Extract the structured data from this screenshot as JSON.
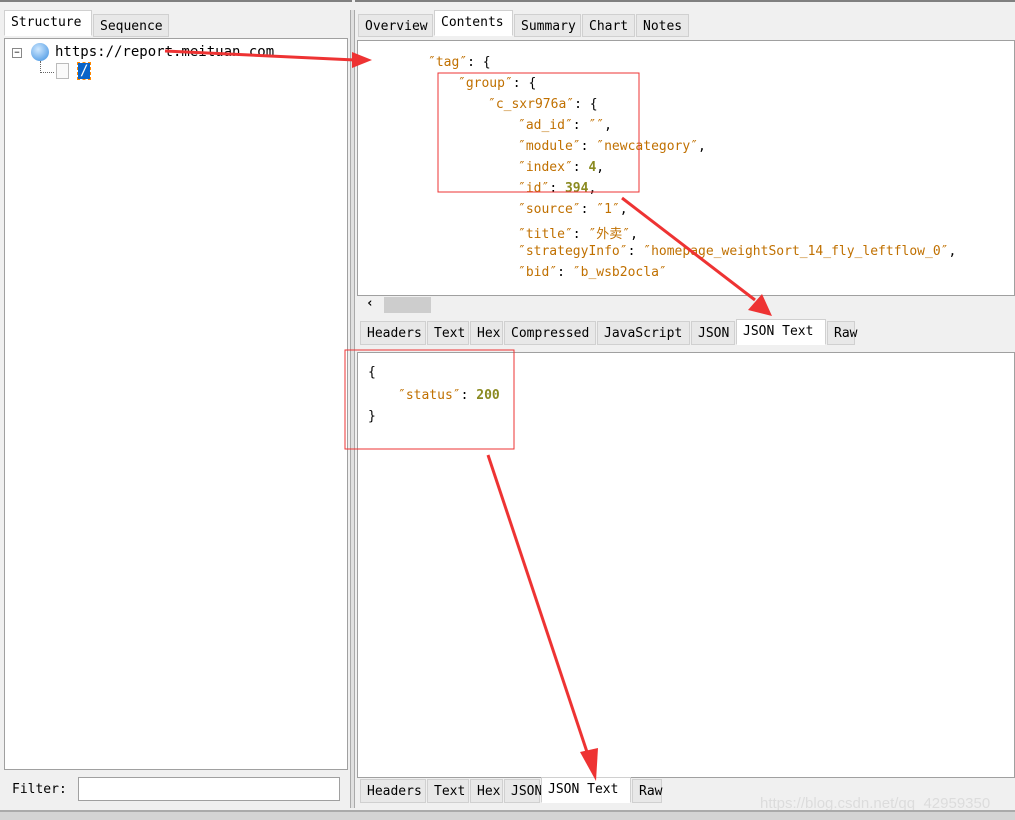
{
  "left": {
    "tabs": [
      {
        "label": "Structure",
        "active": true
      },
      {
        "label": "Sequence",
        "active": false
      }
    ],
    "tree": {
      "host": "https://report.meituan.com",
      "child": "/"
    },
    "filter_label": "Filter:",
    "filter_value": ""
  },
  "right": {
    "top_tabs": [
      {
        "label": "Overview"
      },
      {
        "label": "Contents",
        "active": true
      },
      {
        "label": "Summary"
      },
      {
        "label": "Chart"
      },
      {
        "label": "Notes"
      }
    ],
    "request_json": [
      {
        "indent": 0,
        "key": "tag",
        "punct": ": {"
      },
      {
        "indent": 1,
        "key": "group",
        "punct": ": {"
      },
      {
        "indent": 2,
        "key": "c_sxr976a",
        "punct": ": {"
      },
      {
        "indent": 3,
        "key": "ad_id",
        "str": "",
        "punct": ","
      },
      {
        "indent": 3,
        "key": "module",
        "str": "newcategory",
        "punct": ","
      },
      {
        "indent": 3,
        "key": "index",
        "num": "4",
        "punct": ","
      },
      {
        "indent": 3,
        "key": "id",
        "num": "394",
        "punct": ","
      },
      {
        "indent": 3,
        "key": "source",
        "str": "1",
        "punct": ","
      },
      {
        "indent": 3,
        "key": "title",
        "str": "外卖",
        "punct": ","
      },
      {
        "indent": 3,
        "key": "strategyInfo",
        "str": "homepage_weightSort_14_fly_leftflow_0",
        "punct": ","
      },
      {
        "indent": 3,
        "key": "bid",
        "str": "b_wsb2ocla",
        "punct": ""
      }
    ],
    "request_tabs": [
      {
        "label": "Headers"
      },
      {
        "label": "Text"
      },
      {
        "label": "Hex"
      },
      {
        "label": "Compressed"
      },
      {
        "label": "JavaScript"
      },
      {
        "label": "JSON"
      },
      {
        "label": "JSON Text",
        "active": true
      },
      {
        "label": "Raw"
      }
    ],
    "response_json": {
      "open": "{",
      "key": "status",
      "value": "200",
      "close": "}"
    },
    "response_tabs": [
      {
        "label": "Headers"
      },
      {
        "label": "Text"
      },
      {
        "label": "Hex"
      },
      {
        "label": "JSON"
      },
      {
        "label": "JSON Text",
        "active": true
      },
      {
        "label": "Raw"
      }
    ]
  },
  "watermark": "https://blog.csdn.net/qq_42959350",
  "colors": {
    "annotation": "#ee3333",
    "json_key": "#c07000",
    "json_number": "#8a8a20",
    "selection": "#0a64c8"
  }
}
